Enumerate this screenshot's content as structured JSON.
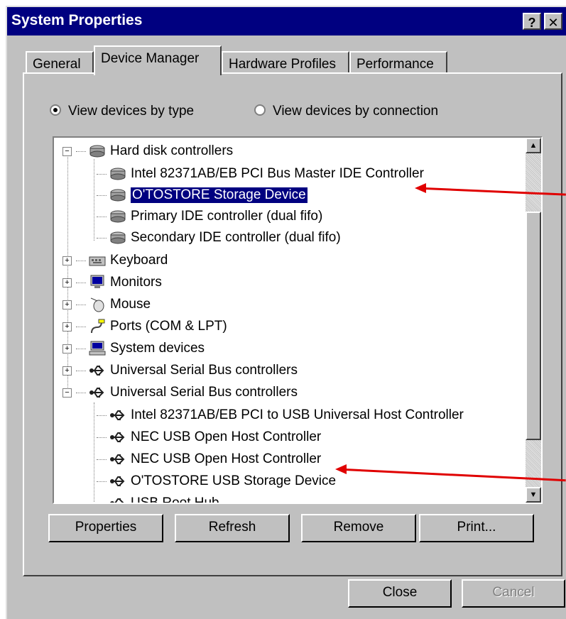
{
  "window": {
    "title": "System Properties",
    "help_label": "?",
    "close_label": "✕"
  },
  "tabs": [
    {
      "label": "General"
    },
    {
      "label": "Device Manager"
    },
    {
      "label": "Hardware Profiles"
    },
    {
      "label": "Performance"
    }
  ],
  "view_options": {
    "by_type": "View devices by type",
    "by_connection": "View devices by connection",
    "selected": "by_type"
  },
  "tree": {
    "groups": [
      {
        "label": "Hard disk controllers",
        "expanded": true,
        "icon": "disk-controller-icon",
        "children": [
          "Intel 82371AB/EB PCI Bus Master IDE Controller",
          "O'TOSTORE Storage Device",
          "Primary IDE controller (dual fifo)",
          "Secondary IDE controller (dual fifo)"
        ]
      },
      {
        "label": "Keyboard",
        "expanded": false,
        "icon": "keyboard-icon"
      },
      {
        "label": "Monitors",
        "expanded": false,
        "icon": "monitor-icon"
      },
      {
        "label": "Mouse",
        "expanded": false,
        "icon": "mouse-icon"
      },
      {
        "label": "Ports (COM & LPT)",
        "expanded": false,
        "icon": "port-icon"
      },
      {
        "label": "System devices",
        "expanded": false,
        "icon": "computer-icon"
      },
      {
        "label": "Universal Serial Bus controllers",
        "expanded": false,
        "icon": "usb-icon"
      },
      {
        "label": "Universal Serial Bus controllers",
        "expanded": true,
        "icon": "usb-icon",
        "children": [
          "Intel 82371AB/EB PCI to USB Universal Host Controller",
          "NEC USB Open Host Controller",
          "NEC USB Open Host Controller",
          "O'TOSTORE USB Storage Device",
          "USB Root Hub"
        ]
      }
    ],
    "selected_item": "O'TOSTORE Storage Device"
  },
  "buttons": {
    "properties": "Properties",
    "refresh": "Refresh",
    "remove": "Remove",
    "print": "Print...",
    "close": "Close",
    "cancel": "Cancel"
  },
  "colors": {
    "title_bar": "#000080",
    "face": "#c0c0c0",
    "selection": "#000080",
    "annotation_arrow": "#e00000"
  }
}
